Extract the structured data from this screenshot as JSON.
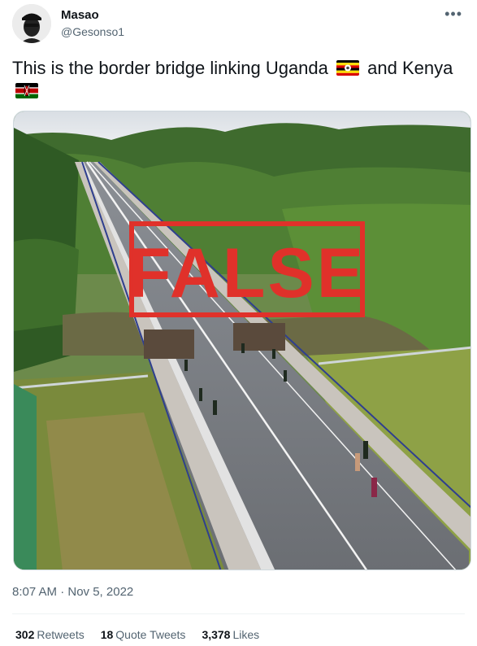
{
  "tweet": {
    "author_name": "Masao",
    "author_handle": "@Gesonso1",
    "more_icon": "more-horizontal-icon",
    "text_part1": "This is the border bridge linking Uganda",
    "text_part2": "and Kenya",
    "flags": [
      "uganda-flag",
      "kenya-flag"
    ],
    "image_stamp": "FALSE",
    "timestamp": "8:07 AM · Nov 5, 2022",
    "stats": {
      "retweets_count": "302",
      "retweets_label": "Retweets",
      "quotes_count": "18",
      "quotes_label": "Quote Tweets",
      "likes_count": "3,378",
      "likes_label": "Likes"
    }
  },
  "colors": {
    "stamp_red": "#e0312a",
    "secondary_text": "#536471",
    "primary_text": "#0f1419"
  }
}
